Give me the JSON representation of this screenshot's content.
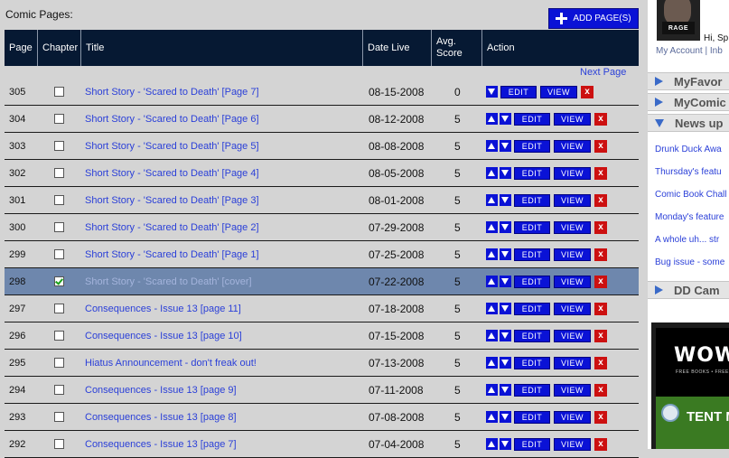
{
  "main": {
    "section_title": "Comic Pages:",
    "add_button": "ADD PAGE(S)",
    "next_page": "Next Page"
  },
  "table": {
    "headers": [
      "Page",
      "Chapter",
      "Title",
      "Date Live",
      "Avg. Score",
      "Action"
    ],
    "action_labels": {
      "edit": "EDIT",
      "view": "VIEW",
      "delete": "x"
    },
    "rows": [
      {
        "page": "305",
        "title": "Short Story - 'Scared to Death' [Page 7]",
        "date": "08-15-2008",
        "score": "0",
        "chapter": false
      },
      {
        "page": "304",
        "title": "Short Story - 'Scared to Death' [Page 6]",
        "date": "08-12-2008",
        "score": "5",
        "chapter": false
      },
      {
        "page": "303",
        "title": "Short Story - 'Scared to Death' [Page 5]",
        "date": "08-08-2008",
        "score": "5",
        "chapter": false
      },
      {
        "page": "302",
        "title": "Short Story - 'Scared to Death' [Page 4]",
        "date": "08-05-2008",
        "score": "5",
        "chapter": false
      },
      {
        "page": "301",
        "title": "Short Story - 'Scared to Death' [Page 3]",
        "date": "08-01-2008",
        "score": "5",
        "chapter": false
      },
      {
        "page": "300",
        "title": "Short Story - 'Scared to Death' [Page 2]",
        "date": "07-29-2008",
        "score": "5",
        "chapter": false
      },
      {
        "page": "299",
        "title": "Short Story - 'Scared to Death' [Page 1]",
        "date": "07-25-2008",
        "score": "5",
        "chapter": false
      },
      {
        "page": "298",
        "title": "Short Story - 'Scared to Death' [cover]",
        "date": "07-22-2008",
        "score": "5",
        "chapter": true
      },
      {
        "page": "297",
        "title": "Consequences - Issue 13 [page 11]",
        "date": "07-18-2008",
        "score": "5",
        "chapter": false
      },
      {
        "page": "296",
        "title": "Consequences - Issue 13 [page 10]",
        "date": "07-15-2008",
        "score": "5",
        "chapter": false
      },
      {
        "page": "295",
        "title": "Hiatus Announcement - don't freak out!",
        "date": "07-13-2008",
        "score": "5",
        "chapter": false
      },
      {
        "page": "294",
        "title": "Consequences - Issue 13 [page 9]",
        "date": "07-11-2008",
        "score": "5",
        "chapter": false
      },
      {
        "page": "293",
        "title": "Consequences - Issue 13 [page 8]",
        "date": "07-08-2008",
        "score": "5",
        "chapter": false
      },
      {
        "page": "292",
        "title": "Consequences - Issue 13 [page 7]",
        "date": "07-04-2008",
        "score": "5",
        "chapter": false
      }
    ]
  },
  "sidebar": {
    "avatar_caption": "RAGE",
    "greeting": "Hi, Sp",
    "my_account": "My Account",
    "separator": " | ",
    "inbox": "Inb",
    "sections": {
      "favorites": "MyFavor",
      "comics": "MyComic",
      "news": "News up",
      "ddcam": "DD Cam"
    },
    "news_items": [
      "Drunk Duck Awa",
      "Thursday's featu",
      "Comic Book Chall",
      "Monday's feature",
      "A whole uh... str",
      "Bug issue - some"
    ],
    "ad": {
      "logo": "WOW",
      "tagline": "FREE BOOKS • FREE",
      "art_text": "TENT MUSI"
    }
  },
  "colors": {
    "page_bg": "#d4d4d4",
    "header_bg": "#061933",
    "button_blue": "#0a12d6",
    "link_blue": "#2a3fd8",
    "delete_red": "#cc1010",
    "selected_row": "#6e87ad"
  },
  "icons": {
    "add": "plus-icon",
    "move_up": "arrow-up-icon",
    "move_down": "arrow-down-icon",
    "delete": "delete-x-icon",
    "collapsed": "triangle-right-icon",
    "expanded": "triangle-down-icon"
  }
}
